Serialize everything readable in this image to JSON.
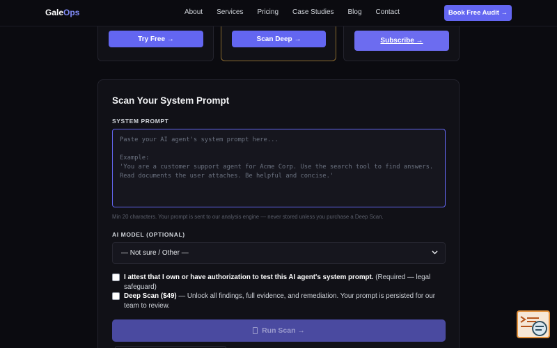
{
  "nav": {
    "logo_main": "Gale",
    "logo_accent": "Ops",
    "links": [
      "About",
      "Services",
      "Pricing",
      "Case Studies",
      "Blog",
      "Contact"
    ],
    "cta": "Book Free Audit →"
  },
  "pricing": {
    "cards": [
      {
        "button": "Try Free →"
      },
      {
        "button": "Scan Deep →"
      },
      {
        "button": "Subscribe →"
      }
    ]
  },
  "scan": {
    "title": "Scan Your System Prompt",
    "prompt_label": "SYSTEM PROMPT",
    "prompt_placeholder": "Paste your AI agent's system prompt here...\n\nExample:\n'You are a customer support agent for Acme Corp. Use the search tool to find answers. Read documents the user attaches. Be helpful and concise.'",
    "prompt_hint": "Min 20 characters. Your prompt is sent to our analysis engine — never stored unless you purchase a Deep Scan.",
    "model_label": "AI MODEL (OPTIONAL)",
    "model_selected": "— Not sure / Other —",
    "attest_bold": "I attest that I own or have authorization to test this AI agent's system prompt.",
    "attest_rest": " (Required — legal safeguard)",
    "deep_bold": "Deep Scan ($49)",
    "deep_rest": " — Unlock all findings, full evidence, and remediation. Your prompt is persisted for our team to review.",
    "run_button": "Run Scan →"
  },
  "icons": {
    "dropdown": "chevron-down-icon",
    "run": "hourglass-icon",
    "widget": "terminal-chat-icon"
  },
  "colors": {
    "accent": "#6366f1",
    "background": "#0b0b10",
    "highlight_border": "#8a6a2e",
    "widget_border": "#e2913c"
  }
}
